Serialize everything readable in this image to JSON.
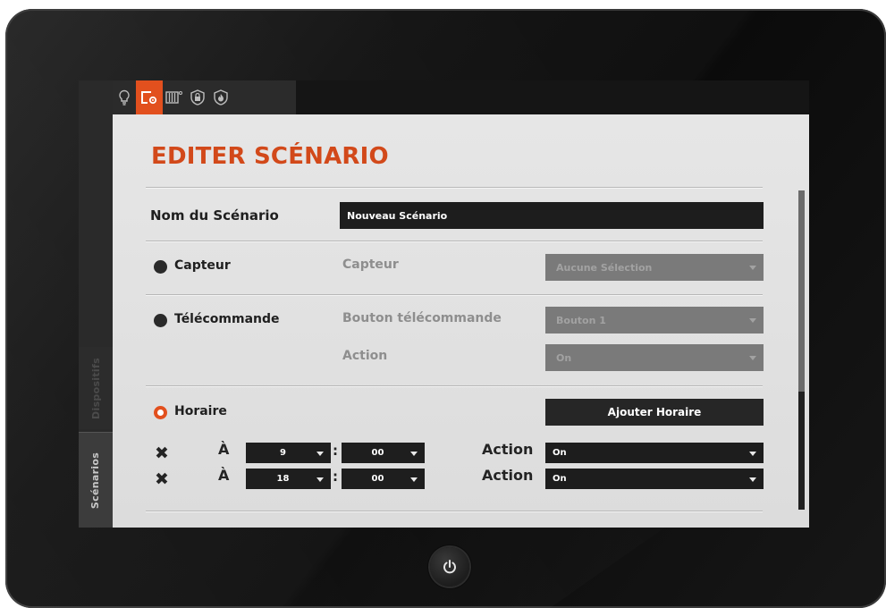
{
  "sidebar": {
    "tabs": [
      {
        "label": "Dispositifs",
        "active": false
      },
      {
        "label": "Scénarios",
        "active": true
      }
    ]
  },
  "topbar": {
    "icons": [
      {
        "name": "lightbulb-icon",
        "active": false
      },
      {
        "name": "scenario-icon",
        "active": true
      },
      {
        "name": "heater-icon",
        "active": false
      },
      {
        "name": "security-lock-icon",
        "active": false
      },
      {
        "name": "fire-alarm-icon",
        "active": false
      }
    ]
  },
  "page": {
    "title": "EDITER SCÉNARIO"
  },
  "form": {
    "name_label": "Nom du Scénario",
    "name_value": "Nouveau Scénario",
    "capteur": {
      "label": "Capteur",
      "field_label": "Capteur",
      "select_value": "Aucune Sélection"
    },
    "telecommande": {
      "label": "Télécommande",
      "button_label": "Bouton télécommande",
      "button_value": "Bouton 1",
      "action_label": "Action",
      "action_value": "On"
    },
    "horaire": {
      "label": "Horaire",
      "add_button": "Ajouter Horaire",
      "schedules": [
        {
          "at_label": "À",
          "hour": "9",
          "minute": "00",
          "action_label": "Action",
          "action_value": "On"
        },
        {
          "at_label": "À",
          "hour": "18",
          "minute": "00",
          "action_label": "Action",
          "action_value": "On"
        }
      ]
    }
  },
  "colors": {
    "accent": "#e2501e",
    "panel_bg": "#e2e2e2",
    "dark_field": "#1d1d1d",
    "disabled_field": "#7a7a7a"
  }
}
